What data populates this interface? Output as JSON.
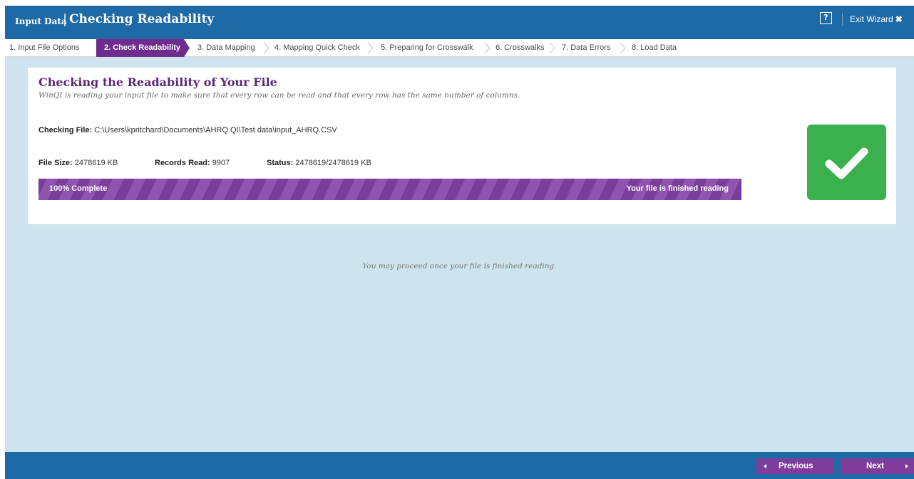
{
  "header": {
    "section": "Input Data",
    "separator": "|",
    "title": "Checking Readability",
    "help_label": "?",
    "exit_label": "Exit Wizard",
    "exit_icon": "✖"
  },
  "steps": [
    {
      "label": "1. Input File Options",
      "active": false
    },
    {
      "label": "2. Check Readability",
      "active": true
    },
    {
      "label": "3. Data Mapping",
      "active": false
    },
    {
      "label": "4. Mapping Quick Check",
      "active": false
    },
    {
      "label": "5. Preparing for Crosswalk",
      "active": false
    },
    {
      "label": "6. Crosswalks",
      "active": false
    },
    {
      "label": "7. Data Errors",
      "active": false
    },
    {
      "label": "8. Load Data",
      "active": false
    }
  ],
  "card": {
    "title": "Checking the Readability of Your File",
    "subtitle": "WinQI is reading your input file to make sure that every row can be read and that every row has the same number of columns.",
    "checking_label": "Checking File:",
    "checking_path": "C:\\Users\\kpritchard\\Documents\\AHRQ QI\\Test data\\input_AHRQ.CSV",
    "file_size_label": "File Size:",
    "file_size_value": "2478619 KB",
    "records_label": "Records Read:",
    "records_value": "9907",
    "status_label": "Status:",
    "status_value": "2478619/2478619 KB",
    "progress_fraction": 1.0,
    "progress_left_text": "100% Complete",
    "progress_right_text": "Your file is finished reading"
  },
  "proceed_message": "You may proceed once your file is finished reading.",
  "footer": {
    "previous_label": "Previous",
    "next_label": "Next"
  },
  "colors": {
    "header_blue": "#1e6aa6",
    "accent_purple": "#6e2d8e",
    "success_green": "#3bb14d",
    "background": "#cfe3ee"
  },
  "icons": {
    "status": "checkmark-icon",
    "help": "help-icon",
    "exit": "close-icon"
  }
}
